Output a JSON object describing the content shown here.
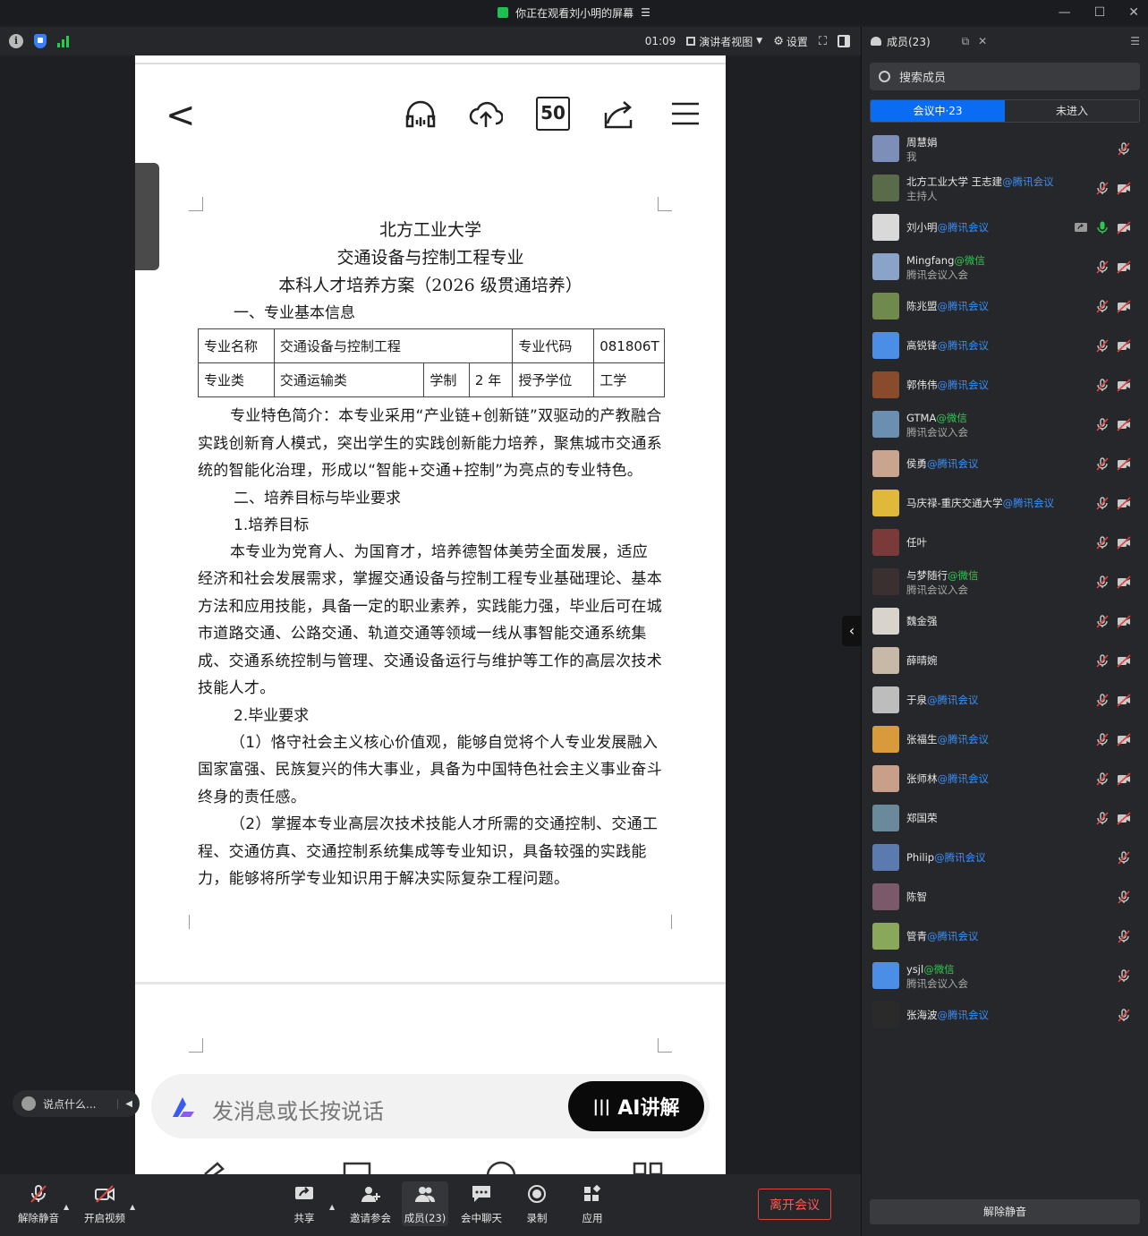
{
  "titlebar": {
    "text": "你正在观看刘小明的屏幕",
    "menu_icon": "list-icon",
    "min_label": "—",
    "max_label": "☐",
    "close_label": "✕"
  },
  "toolbar": {
    "timer": "01:09",
    "view_label": "演讲者视图",
    "settings_label": "设置"
  },
  "shared_screen": {
    "phone_nav_box": "50",
    "doc": {
      "title_lines": [
        "北方工业大学",
        "交通设备与控制工程专业",
        "本科人才培养方案（2026 级贯通培养）"
      ],
      "section1": "一、专业基本信息",
      "table": {
        "r1": [
          "专业名称",
          "交通设备与控制工程",
          "专业代码",
          "081806T"
        ],
        "r2": [
          "专业类",
          "交通运输类",
          "学制",
          "2 年",
          "授予学位",
          "工学"
        ]
      },
      "para1": "专业特色简介：本专业采用“产业链+创新链”双驱动的产教融合实践创新育人模式，突出学生的实践创新能力培养，聚焦城市交通系统的智能化治理，形成以“智能+交通+控制”为亮点的专业特色。",
      "section2": "二、培养目标与毕业要求",
      "sub1": "1.培养目标",
      "para2": "本专业为党育人、为国育才，培养德智体美劳全面发展，适应经济和社会发展需求，掌握交通设备与控制工程专业基础理论、基本方法和应用技能，具备一定的职业素养，实践能力强，毕业后可在城市道路交通、公路交通、轨道交通等领域一线从事智能交通系统集成、交通系统控制与管理、交通设备运行与维护等工作的高层次技术技能人才。",
      "sub2": "2.毕业要求",
      "para3": "（1）恪守社会主义核心价值观，能够自觉将个人专业发展融入国家富强、民族复兴的伟大事业，具备为中国特色社会主义事业奋斗终身的责任感。",
      "para4": "（2）掌握本专业高层次技术技能人才所需的交通控制、交通工程、交通仿真、交通控制系统集成等专业知识，具备较强的实践能力，能够将所学专业知识用于解决实际复杂工程问题。"
    },
    "chat_placeholder": "发消息或长按说话",
    "ai_button": "AI讲解"
  },
  "talk_pill": {
    "placeholder": "说点什么..."
  },
  "bottombar": {
    "unmute": "解除静音",
    "video": "开启视频",
    "share": "共享",
    "invite": "邀请参会",
    "members": "成员(23)",
    "chat": "会中聊天",
    "record": "录制",
    "apps": "应用",
    "leave": "离开会议"
  },
  "panel": {
    "title": "成员(23)",
    "search_placeholder": "搜索成员",
    "tabs": {
      "in_meeting": "会议中·23",
      "not_joined": "未进入"
    },
    "members": [
      {
        "name": "周慧娟",
        "tag": "",
        "sub": "我",
        "color": "#7d8fb8",
        "cam": false
      },
      {
        "name": "北方工业大学 王志建",
        "tag": "@腾讯会议",
        "sub": "主持人",
        "color": "#5a6b4a",
        "cam": true
      },
      {
        "name": "刘小明",
        "tag": "@腾讯会议",
        "sub": "",
        "color": "#d9d9d9",
        "cam": true,
        "speaking": true
      },
      {
        "name": "Mingfang",
        "tag": "@微信",
        "tagColor": "green",
        "sub": "腾讯会议入会",
        "color": "#8aa3c8",
        "cam": true
      },
      {
        "name": "陈兆盟",
        "tag": "@腾讯会议",
        "sub": "",
        "color": "#6f8a4c",
        "cam": true
      },
      {
        "name": "高锐锋",
        "tag": "@腾讯会议",
        "sub": "",
        "color": "#4a8ee6",
        "cam": true
      },
      {
        "name": "郭伟伟",
        "tag": "@腾讯会议",
        "sub": "",
        "color": "#8a4a2c",
        "cam": true
      },
      {
        "name": "GTMA",
        "tag": "@微信",
        "tagColor": "green",
        "sub": "腾讯会议入会",
        "color": "#6a8fb0",
        "cam": true
      },
      {
        "name": "侯勇",
        "tag": "@腾讯会议",
        "sub": "",
        "color": "#c9a58f",
        "cam": true
      },
      {
        "name": "马庆禄-重庆交通大学",
        "tag": "@腾讯会议",
        "sub": "",
        "color": "#e0b83a",
        "cam": true
      },
      {
        "name": "任叶",
        "tag": "",
        "sub": "",
        "color": "#7a3a3a",
        "cam": true
      },
      {
        "name": "与梦随行",
        "tag": "@微信",
        "tagColor": "green",
        "sub": "腾讯会议入会",
        "color": "#3a3030",
        "cam": true
      },
      {
        "name": "魏金强",
        "tag": "",
        "sub": "",
        "color": "#d8d4cc",
        "cam": true
      },
      {
        "name": "薛晴婉",
        "tag": "",
        "sub": "",
        "color": "#c8b8a8",
        "cam": true
      },
      {
        "name": "于泉",
        "tag": "@腾讯会议",
        "sub": "",
        "color": "#bdbdbd",
        "cam": true
      },
      {
        "name": "张福生",
        "tag": "@腾讯会议",
        "sub": "",
        "color": "#d89a3a",
        "cam": true
      },
      {
        "name": "张师林",
        "tag": "@腾讯会议",
        "sub": "",
        "color": "#c8a08a",
        "cam": true
      },
      {
        "name": "郑国荣",
        "tag": "",
        "sub": "",
        "color": "#6a8a9c",
        "cam": true
      },
      {
        "name": "Philip",
        "tag": "@腾讯会议",
        "sub": "",
        "color": "#5a7ab0",
        "cam": false
      },
      {
        "name": "陈智",
        "tag": "",
        "sub": "",
        "color": "#7a5a6a",
        "cam": false
      },
      {
        "name": "管青",
        "tag": "@腾讯会议",
        "sub": "",
        "color": "#8aa85a",
        "cam": false
      },
      {
        "name": "ysjl",
        "tag": "@微信",
        "tagColor": "green",
        "sub": "腾讯会议入会",
        "color": "#4a8ee6",
        "cam": false
      },
      {
        "name": "张海波",
        "tag": "@腾讯会议",
        "sub": "",
        "color": "#2a2a2a",
        "cam": false
      }
    ],
    "unmute_all": "解除静音"
  }
}
